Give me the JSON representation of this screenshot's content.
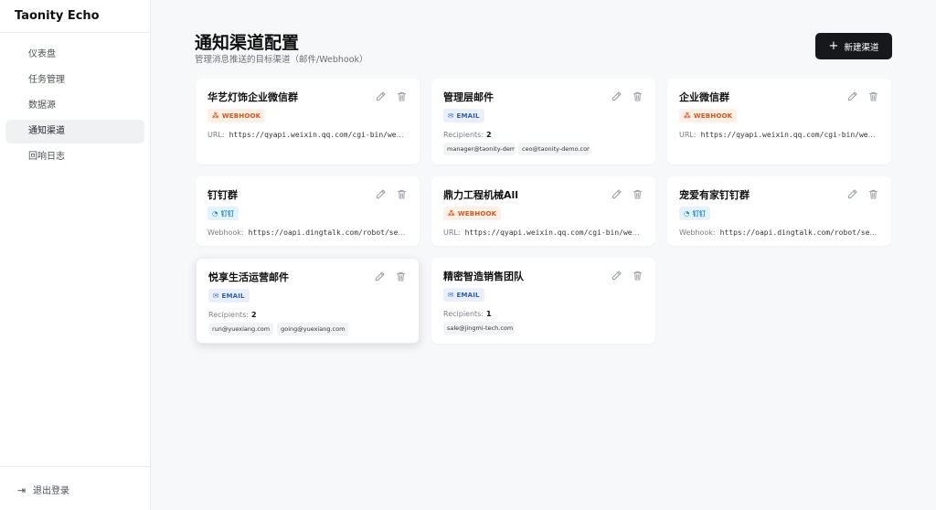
{
  "app": {
    "title": "Taonity Echo"
  },
  "sidebar": {
    "items": [
      {
        "label": "仪表盘"
      },
      {
        "label": "任务管理"
      },
      {
        "label": "数据源"
      },
      {
        "label": "通知渠道"
      },
      {
        "label": "回响日志"
      }
    ],
    "logout_label": "退出登录"
  },
  "header": {
    "title": "通知渠道配置",
    "subtitle": "管理消息推送的目标渠道（邮件/Webhook）",
    "new_button_label": "新建渠道"
  },
  "labels": {
    "url": "URL:",
    "webhook": "Webhook:",
    "recipients": "Recipients:"
  },
  "types": {
    "webhook": "WEBHOOK",
    "email": "EMAIL",
    "dingtalk": "钉钉"
  },
  "channels": [
    {
      "name": "华艺灯饰企业微信群",
      "type": "webhook",
      "url": "https://qyapi.weixin.qq.com/cgi-bin/webhook/..."
    },
    {
      "name": "管理层邮件",
      "type": "email",
      "recipients_count": "2",
      "recipients": [
        "manager@taonity-dem",
        "ceo@taonity-demo.con"
      ]
    },
    {
      "name": "企业微信群",
      "type": "webhook",
      "url": "https://qyapi.weixin.qq.com/cgi-bin/webhook/..."
    },
    {
      "name": "钉钉群",
      "type": "dingtalk",
      "url": "https://oapi.dingtalk.com/robot/send?ac..."
    },
    {
      "name": "鼎力工程机械All",
      "type": "webhook",
      "url": "https://qyapi.weixin.qq.com/cgi-bin/webhook/..."
    },
    {
      "name": "宠爱有家钉钉群",
      "type": "dingtalk",
      "url": "https://oapi.dingtalk.com/robot/send?ac..."
    },
    {
      "name": "悦享生活运营邮件",
      "type": "email",
      "recipients_count": "2",
      "recipients": [
        "run@yuexiang.com",
        "going@yuexiang.com"
      ]
    },
    {
      "name": "精密智造销售团队",
      "type": "email",
      "recipients_count": "1",
      "recipients": [
        "sale@jingmi-tech.com"
      ]
    }
  ],
  "colors": {
    "webhook": "#d9541c",
    "email": "#2f5fc2",
    "dingtalk": "#1f8cc7",
    "primary_button": "#17181b"
  }
}
